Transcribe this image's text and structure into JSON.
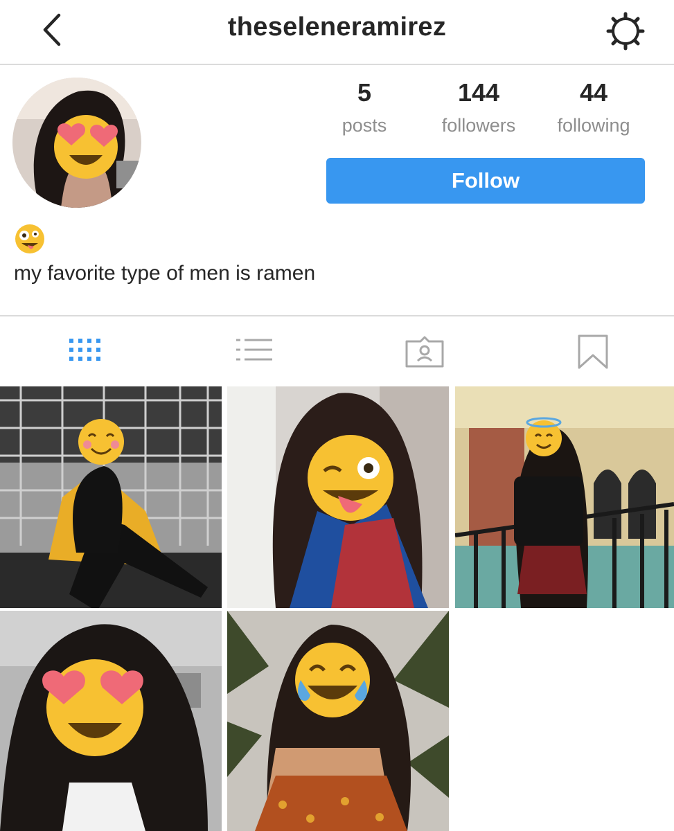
{
  "header": {
    "username": "theseleneramirez",
    "back_icon": "chevron-left-icon",
    "settings_icon": "gear-icon"
  },
  "profile": {
    "stats": [
      {
        "value": "5",
        "label": "posts"
      },
      {
        "value": "144",
        "label": "followers"
      },
      {
        "value": "44",
        "label": "following"
      }
    ],
    "follow_label": "Follow",
    "accent_color": "#3897f0",
    "bio_emoji": "zany-face-emoji",
    "bio": "my favorite type of men is ramen"
  },
  "tabs": [
    {
      "name": "grid",
      "icon": "grid-icon",
      "active": true
    },
    {
      "name": "list",
      "icon": "list-icon",
      "active": false
    },
    {
      "name": "tagged",
      "icon": "tagged-person-icon",
      "active": false
    },
    {
      "name": "saved",
      "icon": "bookmark-icon",
      "active": false
    }
  ],
  "posts": [
    {
      "emoji": "smiling-blush-emoji"
    },
    {
      "emoji": "winking-tongue-emoji"
    },
    {
      "emoji": "halo-emoji"
    },
    {
      "emoji": "heart-eyes-emoji"
    },
    {
      "emoji": "tears-of-joy-emoji"
    }
  ]
}
